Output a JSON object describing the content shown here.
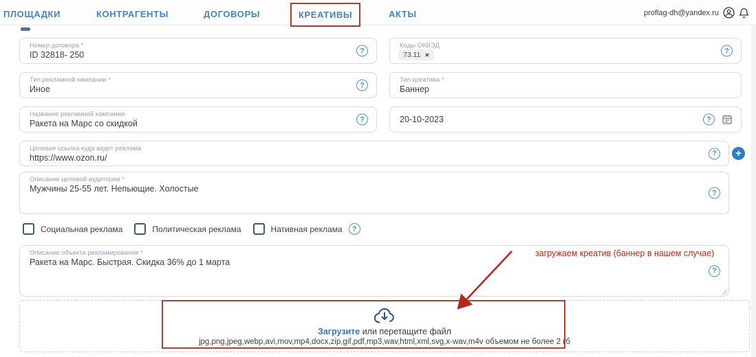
{
  "header": {
    "tabs": [
      {
        "label": "ПЛОЩАДКИ"
      },
      {
        "label": "КОНТРАГЕНТЫ"
      },
      {
        "label": "ДОГОВОРЫ"
      },
      {
        "label": "КРЕАТИВЫ"
      },
      {
        "label": "АКТЫ"
      }
    ],
    "account": {
      "email": "proflag-dh@yandex.ru"
    }
  },
  "icons": {
    "question": "?",
    "plus": "+",
    "remove": "✕"
  },
  "form": {
    "contract_number": {
      "label": "Номер договора *",
      "value": "ID 32818- 250"
    },
    "okved_codes": {
      "label": "Коды ОКВЭД",
      "chip": "73.11"
    },
    "campaign_type": {
      "label": "Тип рекламной кампании *",
      "value": "Иное"
    },
    "creative_type": {
      "label": "Тип креатива *",
      "value": "Баннер"
    },
    "campaign_name": {
      "label": "Название рекламной кампании",
      "value": "Ракета на Марс со скидкой"
    },
    "date": {
      "value": "20-10-2023"
    },
    "target_url": {
      "label": "Целевая ссылка куда ведет реклама",
      "value": "https://www.ozon.ru/"
    },
    "audience": {
      "label": "Описание целевой аудитории *",
      "value": "Мужчины 25-55 лет. Непьющие. Холостые"
    },
    "flags": [
      {
        "label": "Социальная реклама"
      },
      {
        "label": "Политическая реклама"
      },
      {
        "label": "Нативная реклама"
      }
    ],
    "object_description": {
      "label": "Описание объекта рекламирования *",
      "value": "Ракета на Марс. Быстрая. Скидка 36% до 1 марта"
    }
  },
  "upload": {
    "action": "Загрузите",
    "drag_hint": "или перетащите файл",
    "formats": "jpg,png,jpeg,webp,avi,mov,mp4,docx,zip,gif,pdf,mp3,wav,html,xml,svg,x-wav,m4v объемом не более 2 гб"
  },
  "annotation": {
    "note": "загружаем креатив (баннер в нашем случае)"
  },
  "colors": {
    "nav_blue": "#4584c4",
    "accent_blue": "#4a8fd4",
    "annotation_red": "#c0392b",
    "field_border": "#d7dbe0",
    "checkbox_border": "#3a5a80"
  }
}
